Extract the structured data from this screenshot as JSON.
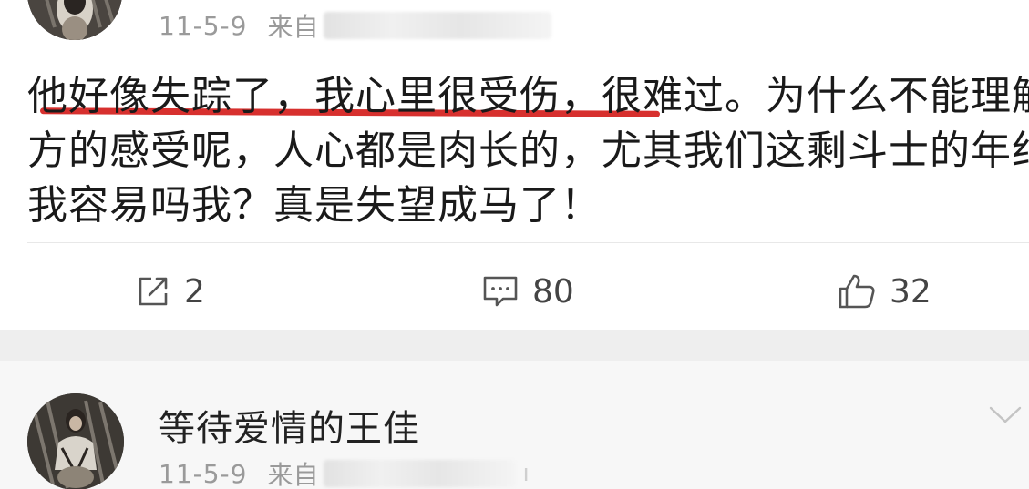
{
  "post1": {
    "time": "11-5-9",
    "source_prefix": "来自",
    "body_lines": [
      "他好像失踪了，我心里很受伤，很难过。为什么不能理解对",
      "方的感受呢，人心都是肉长的，尤其我们这剩斗士的年纪，",
      "我容易吗我？真是失望成马了！"
    ],
    "actions": {
      "share_count": "2",
      "comment_count": "80",
      "like_count": "32"
    },
    "icons": {
      "share": "share-icon",
      "comment": "comment-icon",
      "like": "thumbs-up-icon"
    }
  },
  "post2": {
    "username": "等待爱情的王佳",
    "time": "11-5-9",
    "source_prefix": "来自",
    "source_tail": "ı",
    "icons": {
      "expand": "chevron-down-icon"
    }
  },
  "colors": {
    "highlight_underline": "#d7302e",
    "meta_text": "#9a9a9a",
    "body_text": "#1a1a1a"
  }
}
